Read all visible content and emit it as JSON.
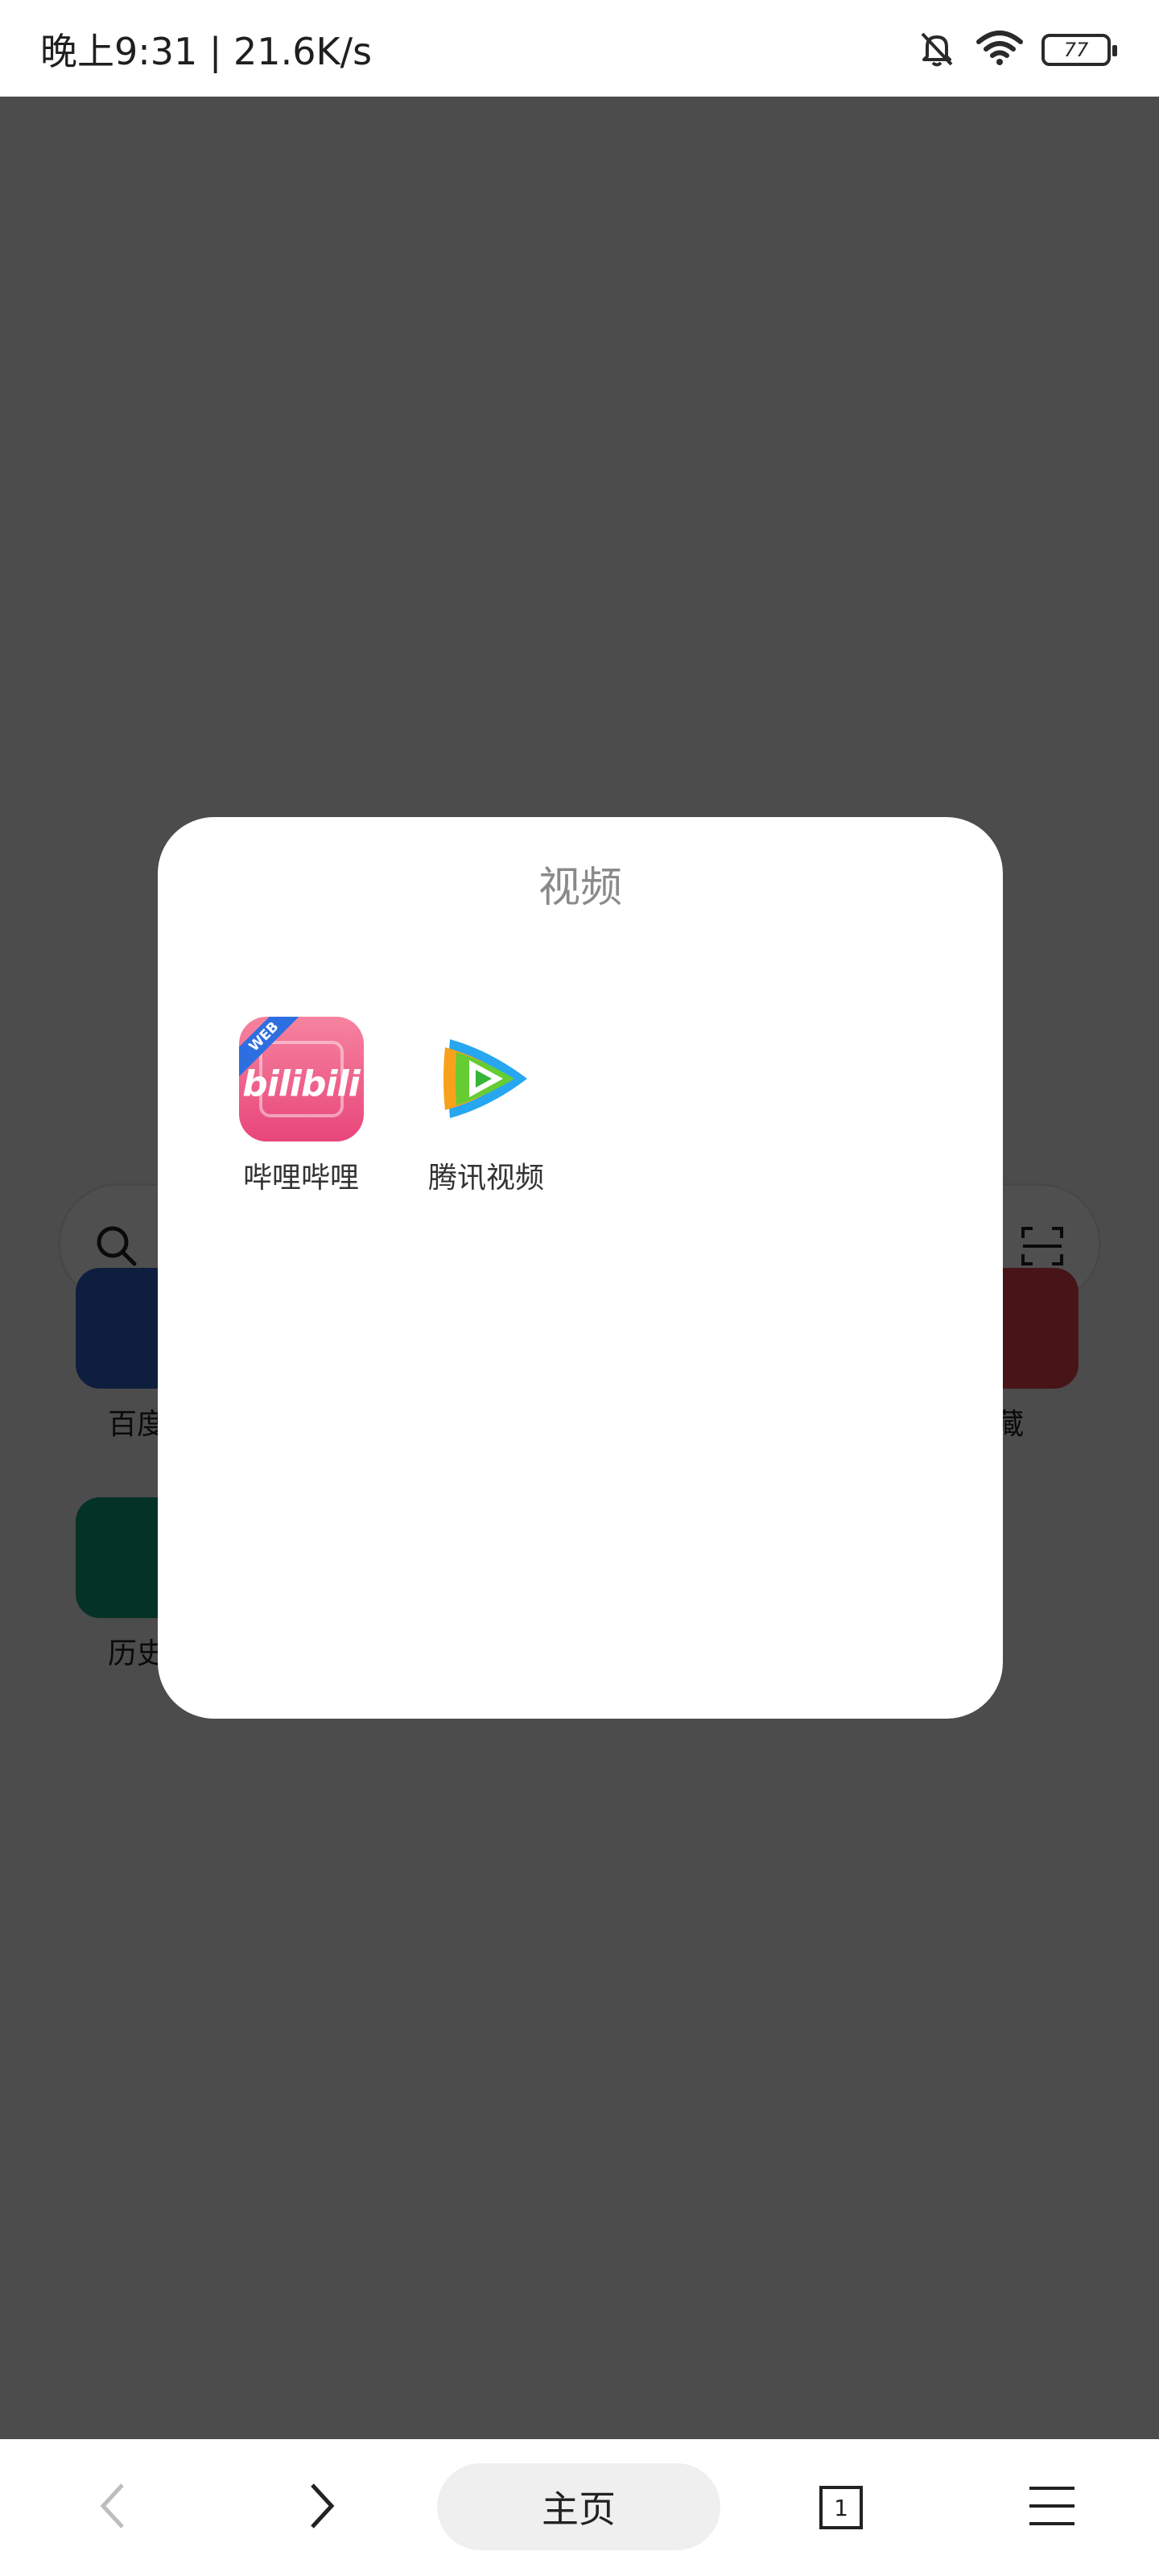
{
  "status_bar": {
    "time_speed": "晚上9:31 | 21.6K/s",
    "battery": "77",
    "icons": [
      "bell-mute-icon",
      "wifi-icon",
      "battery-icon"
    ]
  },
  "background_page": {
    "shortcuts": [
      {
        "label_partial": "百度",
        "color": "#1f4fa0"
      },
      {
        "label_partial": "收藏",
        "color": "#d93a4a"
      },
      {
        "label_partial": "历史",
        "color": "#0f8f72"
      }
    ]
  },
  "folder": {
    "title": "视频",
    "apps": [
      {
        "label": "哔哩哔哩",
        "icon": "bilibili-icon",
        "icon_text": "bilibili",
        "badge": "WEB"
      },
      {
        "label": "腾讯视频",
        "icon": "tencent-video-icon"
      }
    ]
  },
  "bottom_nav": {
    "home_label": "主页",
    "tabs_count": "1",
    "icons": [
      "back-icon",
      "forward-icon",
      "tabs-icon",
      "menu-icon"
    ]
  },
  "colors": {
    "overlay": "#4f4f4f",
    "dialog_bg": "#ffffff",
    "title_text": "#8a8a8a"
  }
}
